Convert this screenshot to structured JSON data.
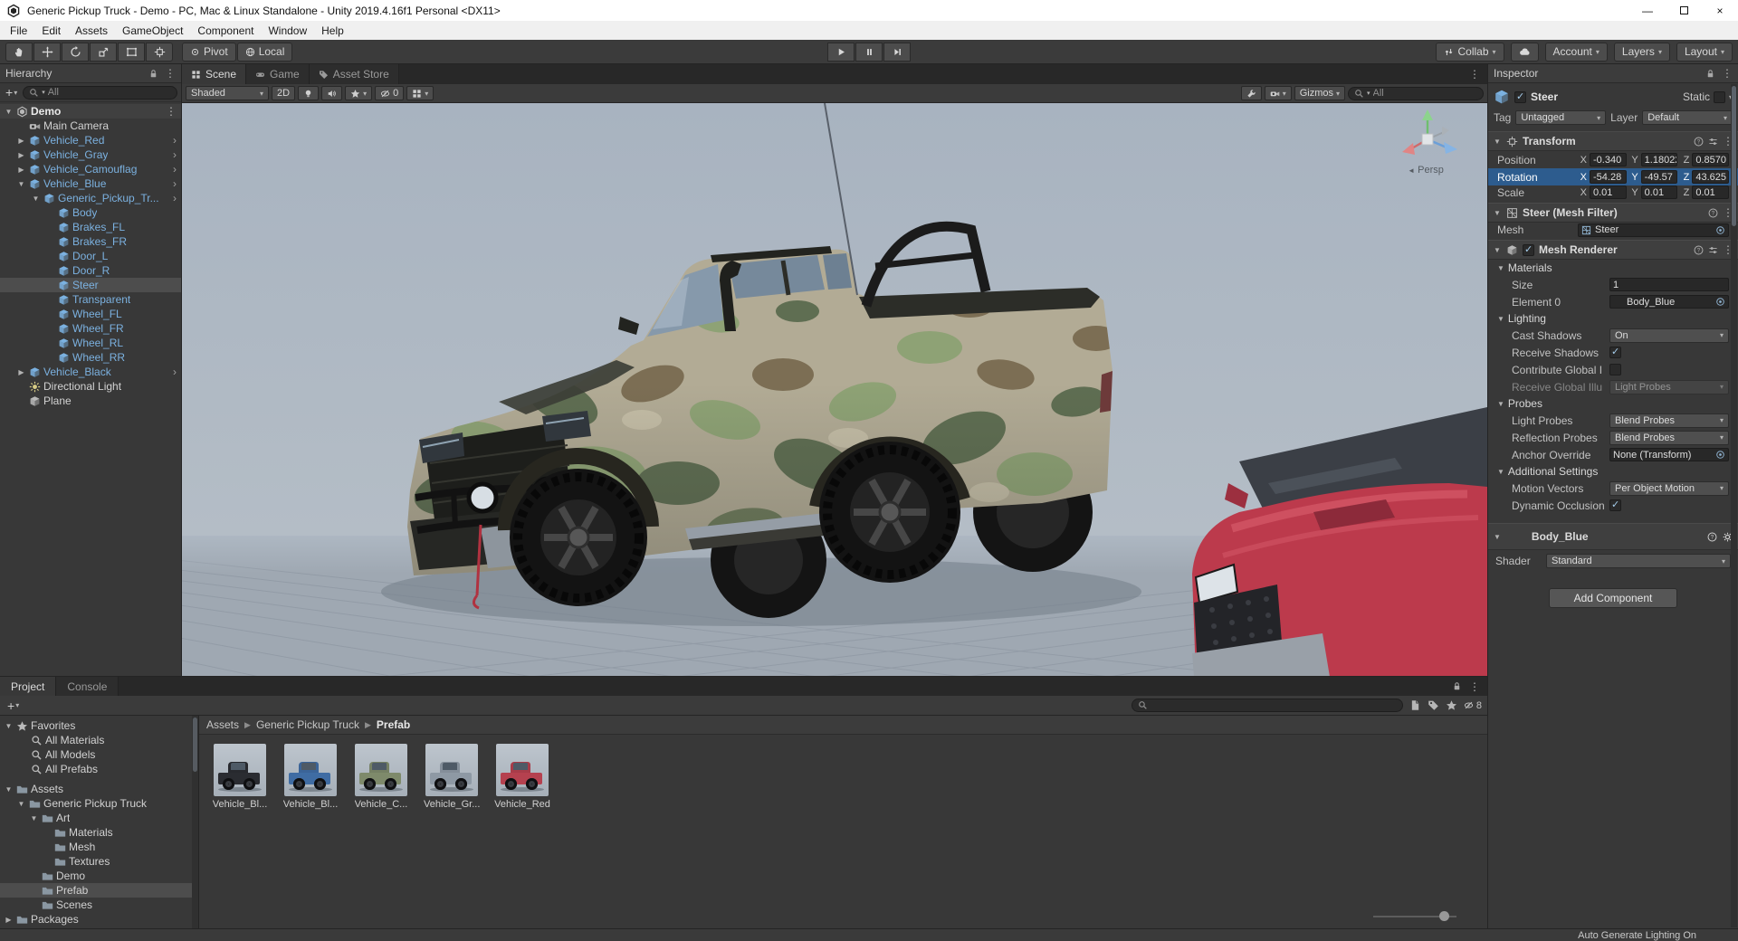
{
  "titlebar": {
    "title": "Generic Pickup Truck - Demo - PC, Mac & Linux Standalone - Unity 2019.4.16f1 Personal <DX11>"
  },
  "menubar": [
    "File",
    "Edit",
    "Assets",
    "GameObject",
    "Component",
    "Window",
    "Help"
  ],
  "toolbar": {
    "pivot": "Pivot",
    "local": "Local",
    "collab": "Collab",
    "account": "Account",
    "layers": "Layers",
    "layout": "Layout"
  },
  "hierarchy": {
    "title": "Hierarchy",
    "search_text": "All",
    "items": [
      "Demo",
      "Main Camera",
      "Vehicle_Red",
      "Vehicle_Gray",
      "Vehicle_Camouflag",
      "Vehicle_Blue",
      "Generic_Pickup_Tr...",
      "Body",
      "Brakes_FL",
      "Brakes_FR",
      "Door_L",
      "Door_R",
      "Steer",
      "Transparent",
      "Wheel_FL",
      "Wheel_FR",
      "Wheel_RL",
      "Wheel_RR",
      "Vehicle_Black",
      "Directional Light",
      "Plane"
    ]
  },
  "scene": {
    "tabs": [
      "Scene",
      "Game",
      "Asset Store"
    ],
    "shading": "Shaded",
    "mode_2d": "2D",
    "hidden_count": "0",
    "gizmos_label": "Gizmos",
    "search_text": "All",
    "persp_label": "Persp",
    "colors": {
      "sky": "#a8b3c0",
      "ground": "#9fa8b2",
      "camo_base": "#b2ab95",
      "camo_green": "#8ea275",
      "camo_dark": "#5f6e52",
      "camo_brown": "#7c6e54",
      "red_truck": "#bc3a4c"
    }
  },
  "inspector": {
    "title": "Inspector",
    "object": {
      "name": "Steer",
      "static_label": "Static",
      "tag_label": "Tag",
      "tag_value": "Untagged",
      "layer_label": "Layer",
      "layer_value": "Default"
    },
    "axis": {
      "x": "X",
      "y": "Y",
      "z": "Z"
    },
    "transform": {
      "title": "Transform",
      "position_label": "Position",
      "rotation_label": "Rotation",
      "scale_label": "Scale",
      "position": {
        "x": "-0.340",
        "y": "1.18022",
        "z": "0.8570"
      },
      "rotation": {
        "x": "-54.28",
        "y": "-49.57",
        "z": "43.625"
      },
      "scale": {
        "x": "0.01",
        "y": "0.01",
        "z": "0.01"
      }
    },
    "mesh_filter": {
      "title": "Steer (Mesh Filter)",
      "mesh_label": "Mesh",
      "mesh_value": "Steer"
    },
    "mesh_renderer": {
      "title": "Mesh Renderer",
      "materials_label": "Materials",
      "size_label": "Size",
      "size_value": "1",
      "element0_label": "Element 0",
      "element0_value": "Body_Blue",
      "lighting_label": "Lighting",
      "cast_shadows_label": "Cast Shadows",
      "cast_shadows_value": "On",
      "receive_shadows_label": "Receive Shadows",
      "contribute_gi_label": "Contribute Global I",
      "receive_gi_label": "Receive Global Illu",
      "receive_gi_value": "Light Probes",
      "probes_label": "Probes",
      "light_probes_label": "Light Probes",
      "light_probes_value": "Blend Probes",
      "reflection_probes_label": "Reflection Probes",
      "reflection_probes_value": "Blend Probes",
      "anchor_label": "Anchor Override",
      "anchor_value": "None (Transform)",
      "additional_label": "Additional Settings",
      "motion_vectors_label": "Motion Vectors",
      "motion_vectors_value": "Per Object Motion",
      "dynamic_occlusion_label": "Dynamic Occlusion"
    },
    "material": {
      "name": "Body_Blue",
      "shader_label": "Shader",
      "shader_value": "Standard"
    },
    "add_component": "Add Component",
    "selection_color": "#2d5c8e"
  },
  "project": {
    "tabs": [
      "Project",
      "Console"
    ],
    "favorites_label": "Favorites",
    "favorites": [
      "All Materials",
      "All Models",
      "All Prefabs"
    ],
    "assets_label": "Assets",
    "tree": [
      "Generic Pickup Truck",
      "Art",
      "Materials",
      "Mesh",
      "Textures",
      "Demo",
      "Prefab",
      "Scenes"
    ],
    "packages_label": "Packages",
    "breadcrumb": [
      "Assets",
      "Generic Pickup Truck",
      "Prefab"
    ],
    "assets": [
      {
        "label": "Vehicle_Bl...",
        "color": "#2a2c31"
      },
      {
        "label": "Vehicle_Bl...",
        "color": "#3f6ca3"
      },
      {
        "label": "Vehicle_C...",
        "color": "#7e8a6b"
      },
      {
        "label": "Vehicle_Gr...",
        "color": "#8e99a4"
      },
      {
        "label": "Vehicle_Red",
        "color": "#b5414f"
      }
    ],
    "hidden_count": "8"
  },
  "statusbar": {
    "lighting": "Auto Generate Lighting On"
  },
  "colors": {
    "selection_blue": "#2d5c8e",
    "selection_gray": "#4d4d4d",
    "prefab_text": "#7bb1e0"
  }
}
